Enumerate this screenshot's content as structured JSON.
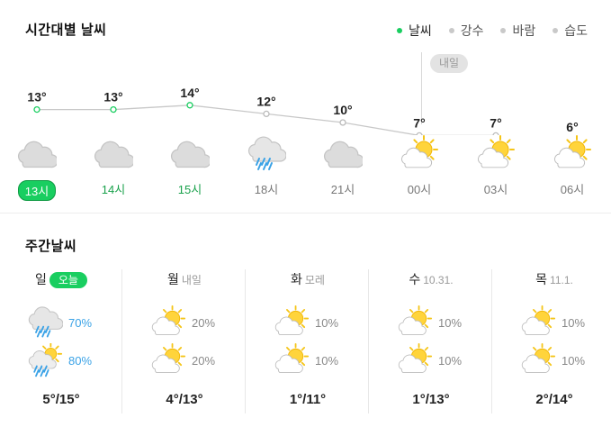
{
  "hourly": {
    "title": "시간대별 날씨",
    "tabs": [
      {
        "label": "날씨",
        "active": true
      },
      {
        "label": "강수",
        "active": false
      },
      {
        "label": "바람",
        "active": false
      },
      {
        "label": "습도",
        "active": false
      }
    ],
    "tomorrow_badge": "내일",
    "hours": [
      {
        "time": "13시",
        "temp": 13,
        "temp_label": "13°",
        "icon": "cloud-icon",
        "state": "now"
      },
      {
        "time": "14시",
        "temp": 13,
        "temp_label": "13°",
        "icon": "cloud-icon",
        "state": "green"
      },
      {
        "time": "15시",
        "temp": 14,
        "temp_label": "14°",
        "icon": "cloud-icon",
        "state": "green"
      },
      {
        "time": "18시",
        "temp": 12,
        "temp_label": "12°",
        "icon": "rain-cloud-icon",
        "state": "normal"
      },
      {
        "time": "21시",
        "temp": 10,
        "temp_label": "10°",
        "icon": "cloud-icon",
        "state": "normal"
      },
      {
        "time": "00시",
        "temp": 7,
        "temp_label": "7°",
        "icon": "sun-cloud-icon",
        "state": "normal"
      },
      {
        "time": "03시",
        "temp": 7,
        "temp_label": "7°",
        "icon": "sun-cloud-icon",
        "state": "normal"
      },
      {
        "time": "06시",
        "temp": 6,
        "temp_label": "6°",
        "icon": "sun-cloud-icon",
        "state": "normal"
      }
    ]
  },
  "weekly": {
    "title": "주간날씨",
    "days": [
      {
        "day": "일",
        "sub": "오늘",
        "is_today": true,
        "am": {
          "icon": "rain-cloud-icon",
          "pct": "70%"
        },
        "pm": {
          "icon": "sun-rain-icon",
          "pct": "80%"
        },
        "temp": "5°/15°"
      },
      {
        "day": "월",
        "sub": "내일",
        "is_today": false,
        "am": {
          "icon": "sun-cloud-icon",
          "pct": "20%"
        },
        "pm": {
          "icon": "sun-cloud-icon",
          "pct": "20%"
        },
        "temp": "4°/13°"
      },
      {
        "day": "화",
        "sub": "모레",
        "is_today": false,
        "am": {
          "icon": "sun-cloud-icon",
          "pct": "10%"
        },
        "pm": {
          "icon": "sun-cloud-icon",
          "pct": "10%"
        },
        "temp": "1°/11°"
      },
      {
        "day": "수",
        "sub": "10.31.",
        "is_today": false,
        "am": {
          "icon": "sun-cloud-icon",
          "pct": "10%"
        },
        "pm": {
          "icon": "sun-cloud-icon",
          "pct": "10%"
        },
        "temp": "1°/13°"
      },
      {
        "day": "목",
        "sub": "11.1.",
        "is_today": false,
        "am": {
          "icon": "sun-cloud-icon",
          "pct": "10%"
        },
        "pm": {
          "icon": "sun-cloud-icon",
          "pct": "10%"
        },
        "temp": "2°/14°"
      }
    ]
  },
  "colors": {
    "accent_green": "#19ce60",
    "rain_blue": "#3aa2e6",
    "sun_yellow": "#ffd43b",
    "cloud_gray": "#d9d9d9"
  }
}
